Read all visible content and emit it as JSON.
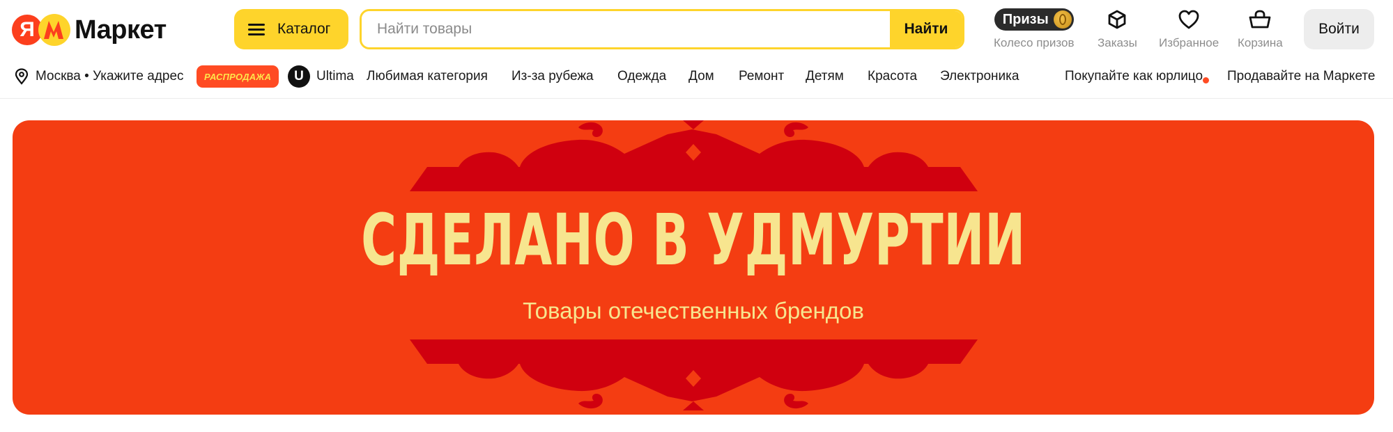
{
  "header": {
    "logo_text": "Маркет",
    "logo_letter": "Я",
    "catalog_label": "Каталог",
    "search_placeholder": "Найти товары",
    "search_button": "Найти",
    "prizes_badge": "Призы",
    "prizes_caption": "Колесо призов",
    "orders_caption": "Заказы",
    "favorites_caption": "Избранное",
    "cart_caption": "Корзина",
    "login_label": "Войти"
  },
  "nav": {
    "location": "Москва • Укажите адрес",
    "sale_badge": "РАСПРОДАЖА",
    "ultima_letter": "U",
    "ultima": "Ultima",
    "items": [
      "Любимая категория",
      "Из-за рубежа",
      "Одежда",
      "Дом",
      "Ремонт",
      "Детям",
      "Красота",
      "Электроника"
    ],
    "business": "Покупайте как юрлицо",
    "sell": "Продавайте на Маркете"
  },
  "banner": {
    "title": "СДЕЛАНО В УДМУРТИИ",
    "subtitle": "Товары отечественных брендов"
  },
  "colors": {
    "brand_yellow": "#fed42b",
    "brand_red": "#fc3f1d",
    "banner_bg": "#f43d12",
    "banner_ornament": "#d0000f",
    "banner_text": "#f7e58f"
  },
  "icons": [
    "location-pin-icon",
    "menu-icon",
    "box-icon",
    "heart-icon",
    "basket-icon",
    "coin-icon"
  ]
}
